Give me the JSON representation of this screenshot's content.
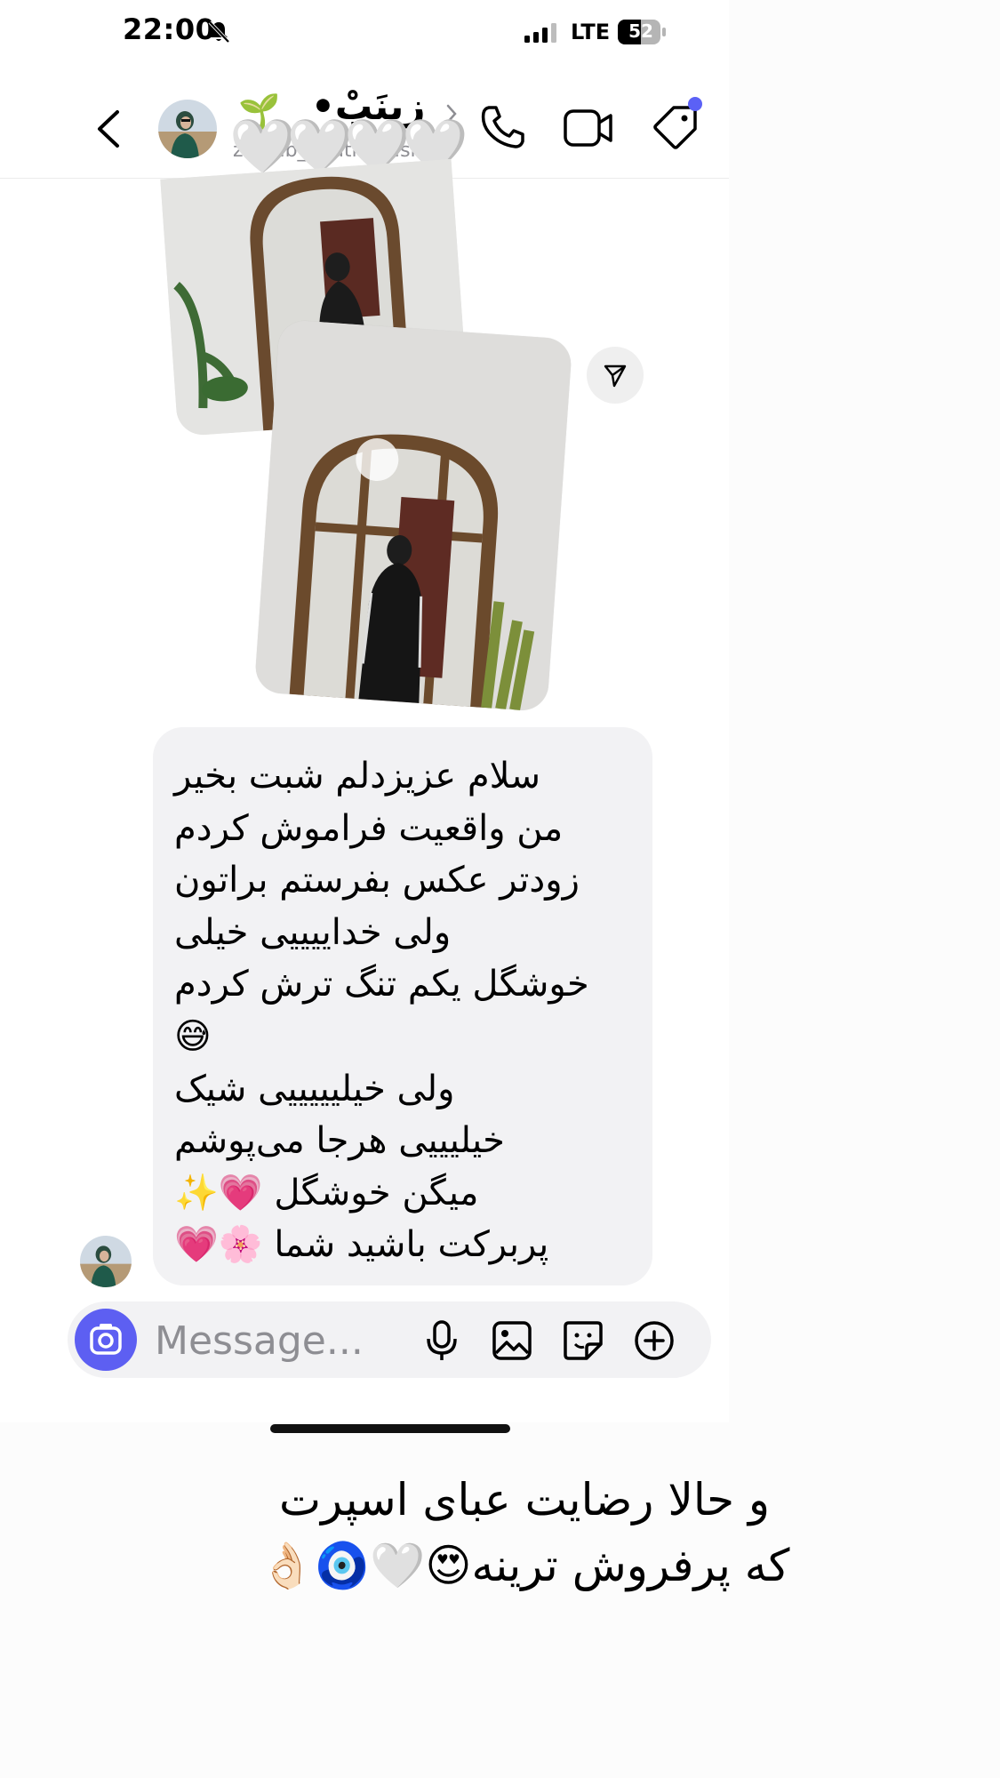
{
  "status_bar": {
    "time": "22:00",
    "carrier": "LTE",
    "battery": "52"
  },
  "header": {
    "contact_name": "زینَبْ•",
    "decoration_emoji": "🌱",
    "username": "zainab_boutique.sla",
    "hearts": "🤍🤍🤍🤍"
  },
  "message": {
    "lines": [
      "سلام عزیزدلم شبت بخیر",
      "من واقعیت فراموش کردم",
      "زودتر عکس بفرستم براتون",
      "ولی خداییییی خیلی",
      "خوشگل یکم تنگ ترش کردم",
      "😅",
      "ولی خیلیییییی شیک",
      "خیلیییی هرجا می‌پوشم",
      "میگن خوشگل 💗✨",
      "پربرکت باشید شما 🌸💗"
    ]
  },
  "composer": {
    "placeholder": "Message..."
  },
  "caption": {
    "line1": "و حالا رضایت عبای اسپرت",
    "line2": "که پرفروش ترینه😍🤍🧿👌🏻"
  },
  "colors": {
    "accent": "#5d5ff2",
    "bubble": "#f2f2f4",
    "notification_dot": "#5b61f6"
  }
}
